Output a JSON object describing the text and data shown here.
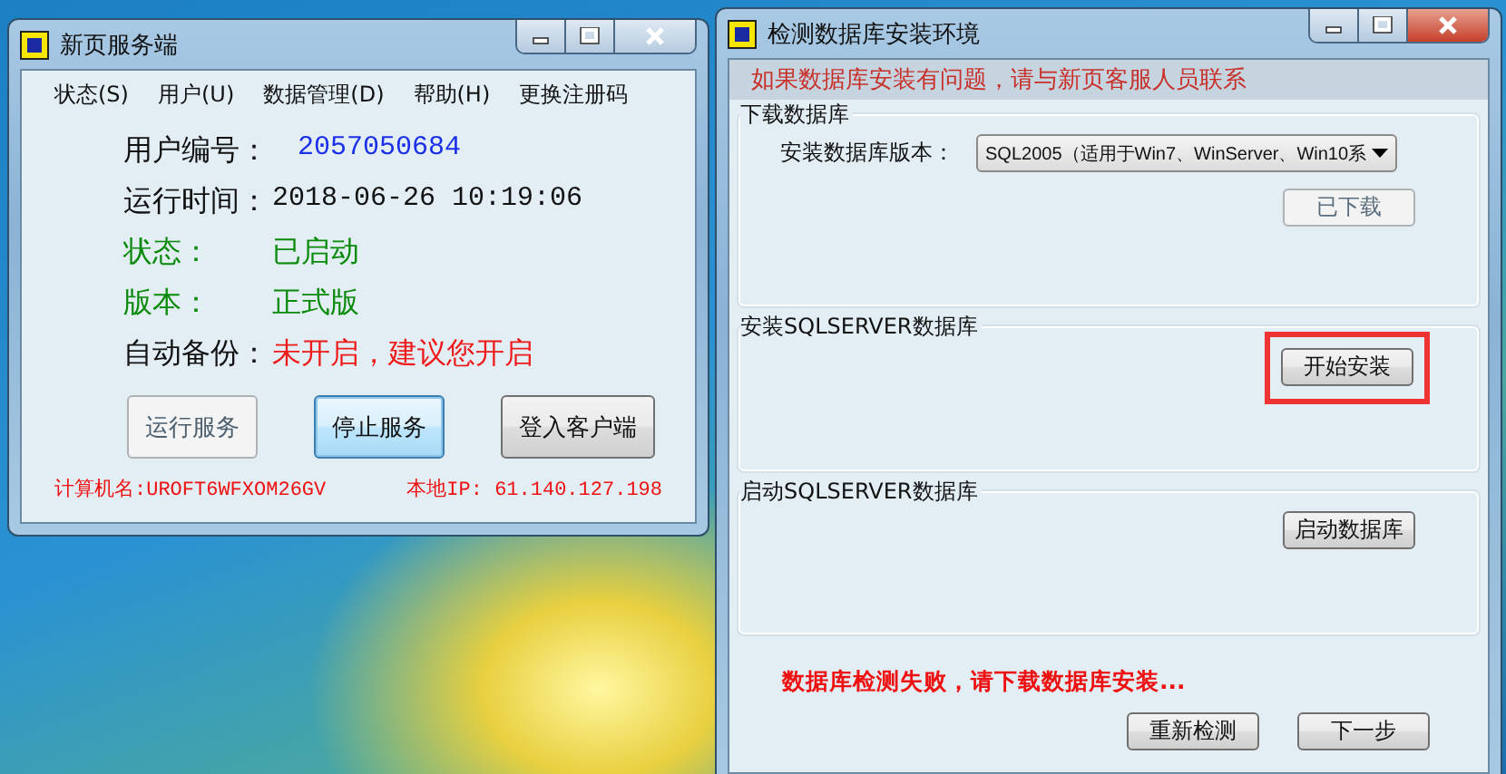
{
  "server_window": {
    "title": "新页服务端",
    "menu": [
      "状态(S)",
      "用户(U)",
      "数据管理(D)",
      "帮助(H)",
      "更换注册码"
    ],
    "fields": [
      {
        "label": "用户编号：",
        "value": "2057050684",
        "kind": "id"
      },
      {
        "label": "运行时间：",
        "value": "2018-06-26 10:19:06",
        "kind": "time"
      },
      {
        "label": "状态：",
        "value": "已启动",
        "kind": "ok"
      },
      {
        "label": "版本：",
        "value": "正式版",
        "kind": "ok"
      },
      {
        "label": "自动备份：",
        "value": "未开启，建议您开启",
        "kind": "warn"
      }
    ],
    "buttons": [
      {
        "label": "运行服务",
        "disabled": true,
        "focused": false
      },
      {
        "label": "停止服务",
        "disabled": false,
        "focused": true
      },
      {
        "label": "登入客户端",
        "disabled": false,
        "focused": false
      }
    ],
    "computer_name": "计算机名:UROFT6WFXOM26GV",
    "local_ip": "本地IP: 61.140.127.198"
  },
  "setup_window": {
    "title": "检测数据库安装环境",
    "notice": "如果数据库安装有问题，请与新页客服人员联系",
    "groups": [
      {
        "title": "下载数据库",
        "select": {
          "label": "安装数据库版本：",
          "value": "SQL2005（适用于Win7、WinServer、Win10系"
        },
        "button": {
          "label": "已下载",
          "disabled": true,
          "highlighted": false
        }
      },
      {
        "title": "安装SQLSERVER数据库",
        "button": {
          "label": "开始安装",
          "disabled": false,
          "highlighted": true
        }
      },
      {
        "title": "启动SQLSERVER数据库",
        "button": {
          "label": "启动数据库",
          "disabled": false,
          "highlighted": false
        }
      }
    ],
    "status": "数据库检测失败，请下载数据库安装...",
    "buttons": [
      {
        "label": "重新检测",
        "disabled": false
      },
      {
        "label": "下一步",
        "disabled": false
      }
    ]
  }
}
